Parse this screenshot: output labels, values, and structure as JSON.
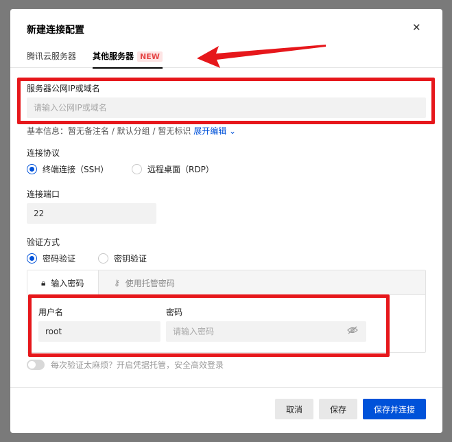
{
  "dialog": {
    "title": "新建连接配置",
    "close_icon": "close-icon"
  },
  "tabs": {
    "tencent_label": "腾讯云服务器",
    "other_label": "其他服务器",
    "new_badge": "NEW"
  },
  "server": {
    "label": "服务器公网IP或域名",
    "value": "",
    "placeholder": "请输入公网IP或域名"
  },
  "basic_info": {
    "text": "基本信息：暂无备注名 / 默认分组 / 暂无标识",
    "expand_link": "展开编辑",
    "expand_icon": "chevron-down-icon"
  },
  "protocol": {
    "label": "连接协议",
    "options": [
      "终端连接（SSH）",
      "远程桌面（RDP）"
    ],
    "selected": "终端连接（SSH）"
  },
  "port": {
    "label": "连接端口",
    "value": "22"
  },
  "auth": {
    "label": "验证方式",
    "options": [
      "密码验证",
      "密钥验证"
    ],
    "selected": "密码验证",
    "panel_tabs": [
      "输入密码",
      "使用托管密码"
    ],
    "active_panel_tab": "输入密码",
    "username_label": "用户名",
    "username_value": "root",
    "password_label": "密码",
    "password_value": "",
    "password_placeholder": "请输入密码"
  },
  "credential_toggle": {
    "text": "每次验证太麻烦？开启凭据托管，安全高效登录",
    "on": false
  },
  "footer": {
    "cancel_label": "取消",
    "save_label": "保存",
    "save_connect_label": "保存并连接"
  },
  "colors": {
    "primary": "#0052d9",
    "annotation_red": "#e6171b",
    "badge_bg": "#fde4e4",
    "badge_text": "#e54545"
  }
}
